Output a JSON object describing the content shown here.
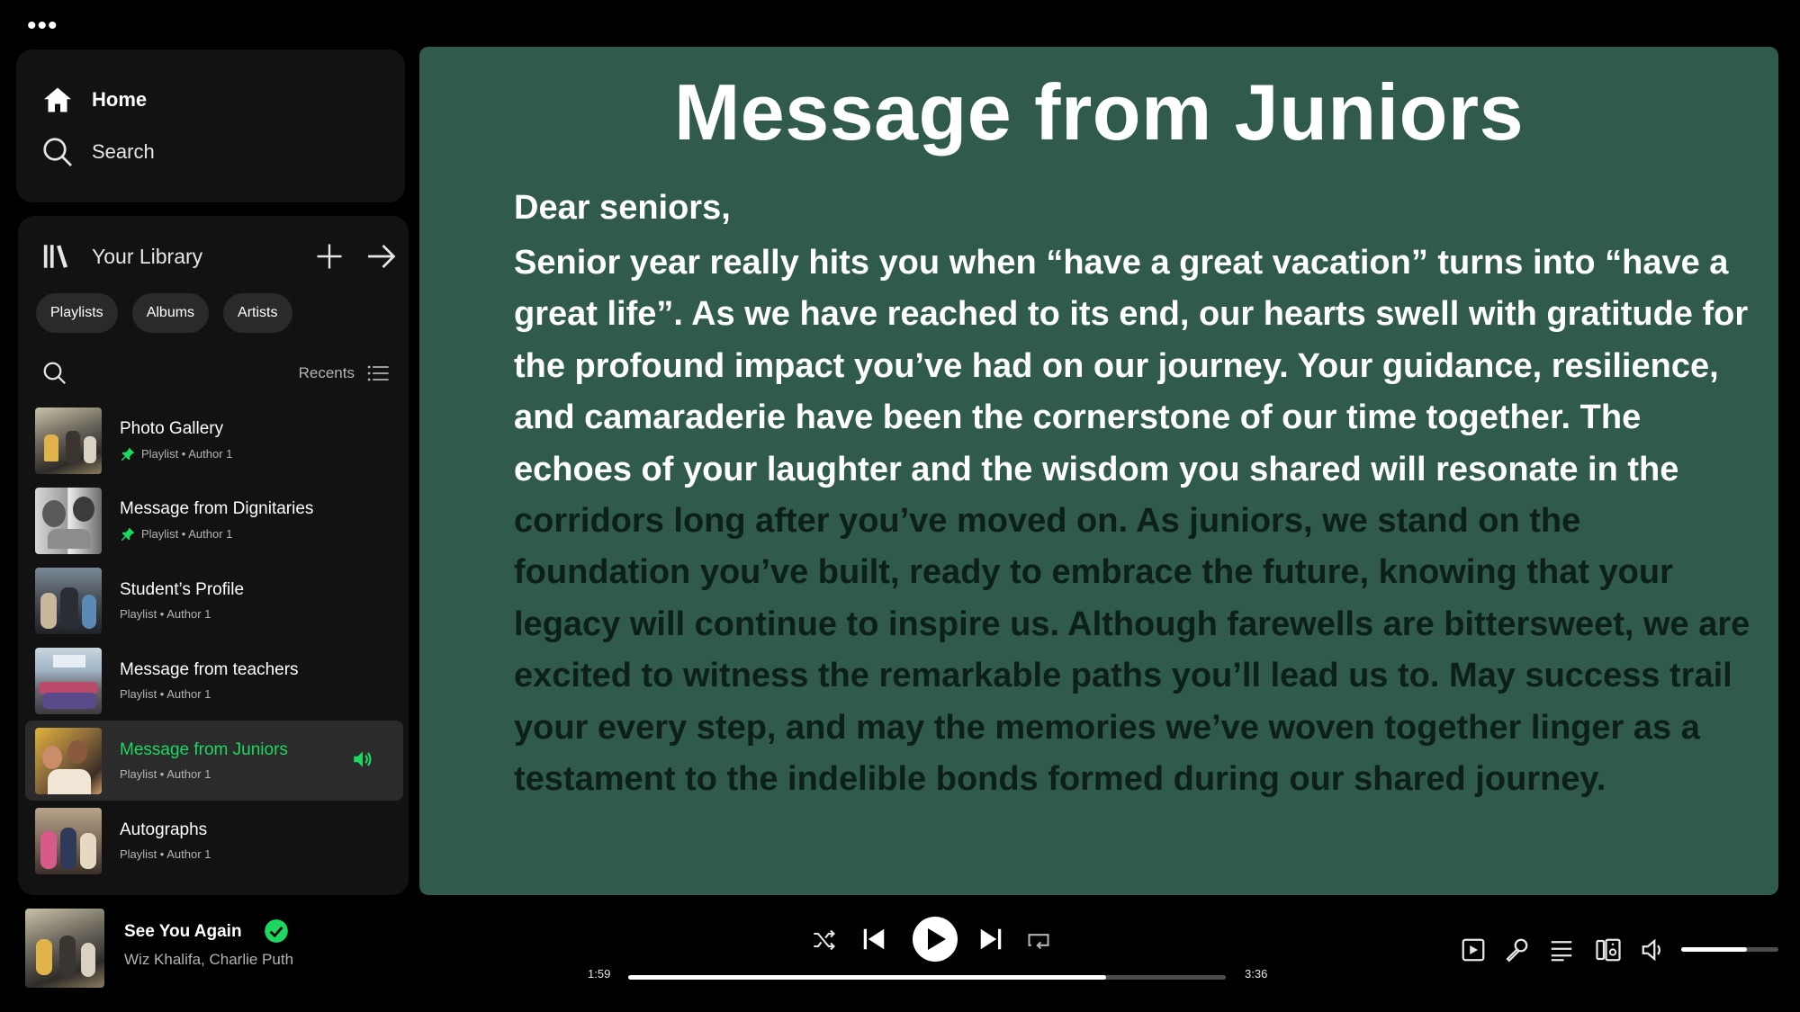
{
  "window": {
    "menu_icon": "more-dots-icon",
    "menu_glyph": "•••"
  },
  "nav": {
    "home_label": "Home",
    "search_label": "Search"
  },
  "library": {
    "title": "Your Library",
    "filters": [
      "Playlists",
      "Albums",
      "Artists"
    ],
    "sort_label": "Recents",
    "items": [
      {
        "title": "Photo Gallery",
        "subtitle": "Playlist • Author 1",
        "pinned": true,
        "active": false
      },
      {
        "title": "Message from Dignitaries",
        "subtitle": "Playlist • Author 1",
        "pinned": true,
        "active": false
      },
      {
        "title": "Student’s Profile",
        "subtitle": "Playlist • Author 1",
        "pinned": false,
        "active": false
      },
      {
        "title": "Message from teachers",
        "subtitle": "Playlist • Author 1",
        "pinned": false,
        "active": false
      },
      {
        "title": "Message from Juniors",
        "subtitle": "Playlist • Author 1",
        "pinned": false,
        "active": true
      },
      {
        "title": "Autographs",
        "subtitle": "Playlist • Author 1",
        "pinned": false,
        "active": false
      }
    ]
  },
  "main": {
    "title": "Message from Juniors",
    "greeting": "Dear seniors,",
    "body_light": "Senior year really hits you when “have a great vacation” turns into “have a great life”. As we have reached to its end, our hearts swell with gratitude for the profound impact you’ve had on our journey. Your guidance, resilience, and camaraderie have been the cornerstone of our time together. The echoes of your laughter and the wisdom you shared will resonate in the ",
    "body_dark": "corridors long after you’ve moved on. As juniors, we stand on the foundation you’ve built, ready to embrace the future, knowing that your legacy will continue to inspire us. Although farewells are bittersweet, we are excited to witness the remarkable paths you’ll lead us to. May success trail your every step, and may the memories we’ve woven together linger as a testament to the indelible bonds formed during our shared journey."
  },
  "player": {
    "track": "See You Again",
    "artist": "Wiz Khalifa, Charlie Puth",
    "elapsed": "1:59",
    "duration": "3:36",
    "progress_fraction": 0.8,
    "volume_fraction": 0.68
  },
  "colors": {
    "accent_green": "#1ed760",
    "main_bg": "#2f5a4c",
    "panel_bg": "#121212"
  }
}
